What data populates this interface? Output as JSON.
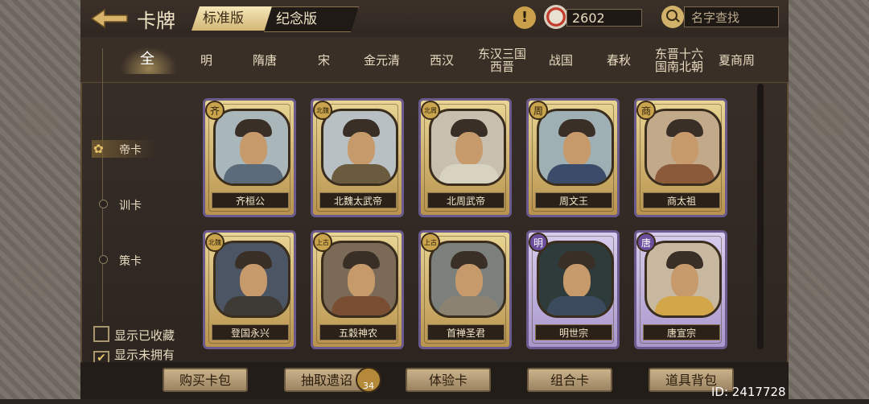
{
  "header": {
    "title": "卡牌",
    "version_tabs": [
      "标准版",
      "纪念版"
    ],
    "coins": "2602",
    "search_placeholder": "名字查找"
  },
  "dynasties": [
    "全",
    "明",
    "隋唐",
    "宋",
    "金元清",
    "西汉",
    "东汉三国\n西晋",
    "战国",
    "春秋",
    "东晋十六\n国南北朝",
    "夏商周"
  ],
  "categories": [
    "帝卡",
    "训卡",
    "策卡"
  ],
  "cards": [
    {
      "name": "齐桓公",
      "badge": "齐",
      "frame": "gold"
    },
    {
      "name": "北魏太武帝",
      "badge": "北魏",
      "frame": "gold"
    },
    {
      "name": "北周武帝",
      "badge": "北周",
      "frame": "gold"
    },
    {
      "name": "周文王",
      "badge": "周",
      "frame": "gold"
    },
    {
      "name": "商太祖",
      "badge": "商",
      "frame": "gold"
    },
    {
      "name": "登国永兴",
      "badge": "北魏",
      "frame": "gold"
    },
    {
      "name": "五穀神农",
      "badge": "上古",
      "frame": "gold"
    },
    {
      "name": "首禅圣君",
      "badge": "上古",
      "frame": "gold"
    },
    {
      "name": "明世宗",
      "badge": "明",
      "frame": "purple"
    },
    {
      "name": "唐宣宗",
      "badge": "唐",
      "frame": "purple"
    }
  ],
  "checkboxes": [
    {
      "label": "显示已收藏",
      "checked": false
    },
    {
      "label": "显示未拥有",
      "checked": true
    }
  ],
  "buttons": [
    "购买卡包",
    "抽取遗诏",
    "体验卡",
    "组合卡",
    "道具背包"
  ],
  "token_count": "34",
  "id_text": "ID: 2417728",
  "colors": {
    "gold_frame": "#e9d594",
    "purple_frame": "#d8cdee",
    "accent": "#e9c46a"
  }
}
